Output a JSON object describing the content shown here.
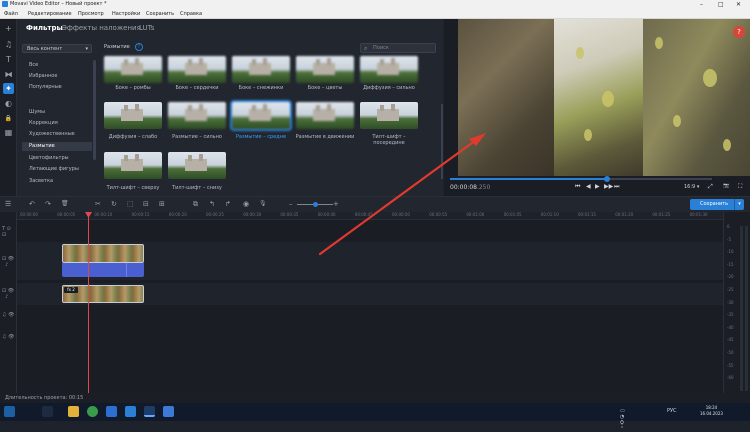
{
  "window": {
    "title": "Movavi Video Editor – Новый проект *",
    "minimize": "–",
    "maximize": "□",
    "close": "✕"
  },
  "menu": [
    "Файл",
    "Редактирование",
    "Просмотр",
    "Настройки",
    "Сохранить",
    "Справка"
  ],
  "tools": [
    {
      "icon": "plus-icon",
      "glyph": "+"
    },
    {
      "icon": "music-note-icon",
      "glyph": "♫"
    },
    {
      "icon": "text-icon",
      "glyph": "T"
    },
    {
      "icon": "transitions-icon",
      "glyph": "⧓"
    },
    {
      "icon": "filters-wand-icon",
      "glyph": "✦"
    },
    {
      "icon": "stickers-icon",
      "glyph": "◐"
    },
    {
      "icon": "lock-icon",
      "glyph": "🔒"
    },
    {
      "icon": "more-tools-icon",
      "glyph": "▦"
    }
  ],
  "tabs": [
    "Фильтры",
    "Эффекты наложения",
    "LUTs"
  ],
  "category_select": "Весь контент",
  "categories": [
    "Все",
    "Избранное",
    "Популярные",
    "Шумы",
    "Коррекция",
    "Художественные",
    "Размытие",
    "Цветофильтры",
    "Летающие фигуры",
    "Засветка"
  ],
  "selected_category": "Размытие",
  "section_title": "Размытие",
  "section_help": "?",
  "search_placeholder": "Поиск",
  "filters": [
    {
      "label": "Боке – ромбы"
    },
    {
      "label": "Боке – сердечки"
    },
    {
      "label": "Боке – снежинки"
    },
    {
      "label": "Боке – цветы"
    },
    {
      "label": "Диффузия – сильно"
    },
    {
      "label": "Диффузия – слабо"
    },
    {
      "label": "Размытие – сильно"
    },
    {
      "label": "Размытие – средне",
      "selected": true
    },
    {
      "label": "Размытие в движении"
    },
    {
      "label": "Тилт-шифт – посередине"
    },
    {
      "label": "Тилт-шифт – сверху"
    },
    {
      "label": "Тилт-шифт – снизу"
    }
  ],
  "preview": {
    "help": "?",
    "timecode": "00:00:08",
    "timecode_frac": ".250",
    "progress": 0.6,
    "aspect": "16:9 ▾",
    "controls": [
      "⏮",
      "◀",
      "▶",
      "▶▶",
      "⏭"
    ],
    "right_controls": [
      "⤢",
      "📷",
      "⛶"
    ]
  },
  "toolbar": {
    "icons": [
      "↶",
      "↷",
      "🗑",
      "✂",
      "↻",
      "⬚",
      "⊟",
      "⊞",
      "⧉",
      "↰",
      "↱",
      "◉",
      "🎙"
    ],
    "zoom_minus": "–",
    "zoom_plus": "+",
    "zoom_level": 0.5,
    "save_label": "Сохранить",
    "save_dropdown": "▾"
  },
  "ruler": [
    "00:00:00",
    "00:00:05",
    "00:00:10",
    "00:00:15",
    "00:00:20",
    "00:00:25",
    "00:00:30",
    "00:00:35",
    "00:00:40",
    "00:00:45",
    "00:00:50",
    "00:00:55",
    "00:01:00",
    "00:01:05",
    "00:01:10",
    "00:01:15",
    "00:01:20",
    "00:01:25",
    "00:01:30"
  ],
  "fx_badge": "fx 2",
  "meter_ticks": [
    "0",
    "-5",
    "-10",
    "-15",
    "-20",
    "-25",
    "-30",
    "-35",
    "-40",
    "-45",
    "-50",
    "-55",
    "-60"
  ],
  "status": "Длительность проекта: 00:15",
  "tray": {
    "lang": "РУС",
    "time": "18:24",
    "date": "16.04.2023"
  }
}
